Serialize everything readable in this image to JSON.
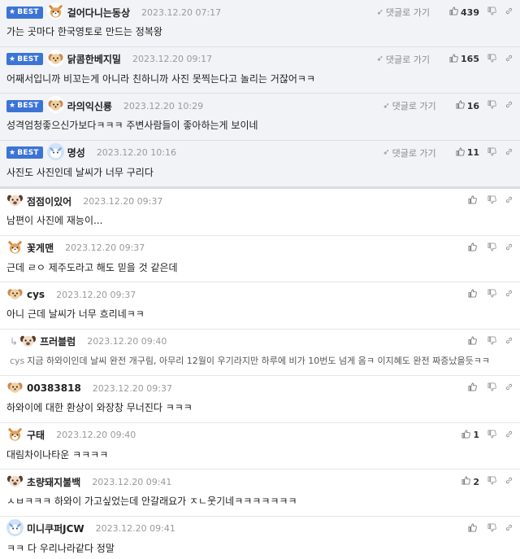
{
  "labels": {
    "best": "BEST",
    "reply": "댓글로 가기"
  },
  "best_comments": [
    {
      "nick": "걸어다니는동상",
      "time": "2023.12.20 07:17",
      "up": "439",
      "text": "가는 곳마다 한국영토로 만드는 정복왕",
      "avatar": "shiba"
    },
    {
      "nick": "닭콤한베지밀",
      "time": "2023.12.20 09:17",
      "up": "165",
      "text": "어째서입니까 비꼬는게 아니라 친하니까 사진 못찍는다고 놀리는 거잖어ㅋㅋ",
      "avatar": "dog"
    },
    {
      "nick": "라의익신룡",
      "time": "2023.12.20 10:29",
      "up": "16",
      "text": "성격엄청좋으신가보다ㅋㅋㅋ 주변사람들이 좋아하는게 보이네",
      "avatar": "dog"
    },
    {
      "nick": "명성",
      "time": "2023.12.20 10:16",
      "up": "11",
      "text": "사진도 사진인데 날씨가 너무 구리다",
      "avatar": "blue"
    }
  ],
  "comments": [
    {
      "nick": "점점이있어",
      "time": "2023.12.20 09:37",
      "up": "",
      "text": "남편이 사진에 재능이...",
      "avatar": "pug",
      "reply": false
    },
    {
      "nick": "꽃게맨",
      "time": "2023.12.20 09:37",
      "up": "",
      "text": "근데 ㄹㅇ 제주도라고 해도 믿을 것 같은데",
      "avatar": "shiba",
      "reply": false
    },
    {
      "nick": "cys",
      "time": "2023.12.20 09:37",
      "up": "",
      "text": "아니 근데 날씨가 너무 흐리네ㅋㅋ",
      "avatar": "dog",
      "reply": false
    },
    {
      "nick": "프러블럼",
      "time": "2023.12.20 09:40",
      "up": "",
      "target": "cys",
      "text": "지금 하와이인데 날씨 완전 개구림, 아무리 12월이 우기라지만 하루에 비가 10번도 넘게 옴ㅋ 이지혜도 완전 짜증났을듯ㅋㅋ",
      "avatar": "pug",
      "reply": true
    },
    {
      "nick": "00383818",
      "time": "2023.12.20 09:37",
      "up": "",
      "text": "하와이에 대한 환상이 와장창 무너진다 ㅋㅋㅋ",
      "avatar": "dog",
      "reply": false
    },
    {
      "nick": "구태",
      "time": "2023.12.20 09:40",
      "up": "1",
      "text": "대림차이나타운 ㅋㅋㅋㅋ",
      "avatar": "shiba",
      "reply": false
    },
    {
      "nick": "초량돼지불백",
      "time": "2023.12.20 09:41",
      "up": "2",
      "text": "ㅅㅂㅋㅋㅋ 하와이 가고싶었는데 안갈래요가 ㅈㄴ웃기네ㅋㅋㅋㅋㅋㅋㅋ",
      "avatar": "pug",
      "reply": false
    },
    {
      "nick": "미니쿠퍼JCW",
      "time": "2023.12.20 09:41",
      "up": "",
      "text": "ㅋㅋ 다 우리나라같다 정말",
      "avatar": "blue",
      "reply": false
    }
  ],
  "colors": {
    "badge": "#3c74d6",
    "best_bg": "#f1f3f7"
  },
  "icons": {
    "thumb_up": "thumb-up-icon",
    "thumb_down": "thumb-down-icon",
    "link": "link-icon",
    "reply_arrow": "reply-arrow-icon",
    "star": "star-icon"
  }
}
